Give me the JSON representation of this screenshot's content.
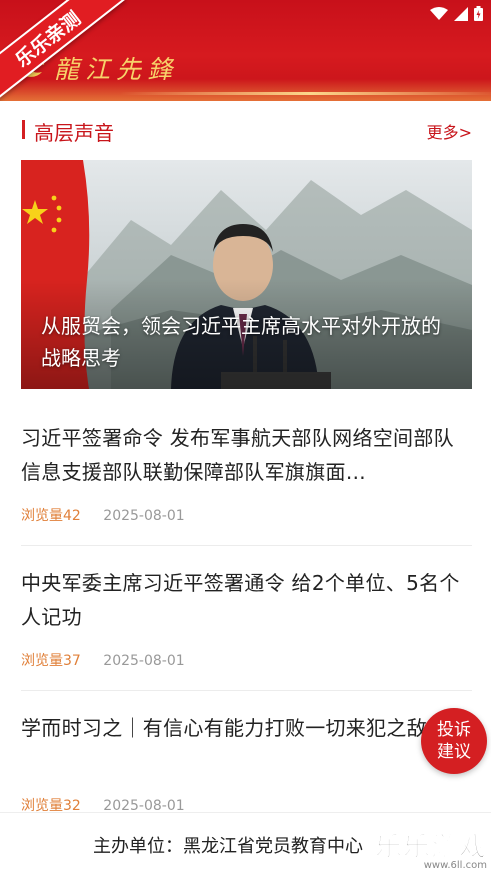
{
  "header": {
    "brand_title": "龍江先鋒",
    "corner_ribbon": "乐乐亲测",
    "colors": {
      "primary": "#c8101a",
      "gold": "#f7d26a"
    }
  },
  "status_bar": {
    "icons": [
      "wifi-icon",
      "signal-icon",
      "battery-icon"
    ]
  },
  "section": {
    "title": "高层声音",
    "more_label": "更多>"
  },
  "feature": {
    "caption": "从服贸会，领会习近平主席高水平对外开放的战略思考"
  },
  "news": [
    {
      "title": "习近平签署命令 发布军事航天部队网络空间部队信息支援部队联勤保障部队军旗旗面…",
      "views": "浏览量42",
      "date": "2025-08-01"
    },
    {
      "title": "中央军委主席习近平签署通令 给2个单位、5名个人记功",
      "views": "浏览量37",
      "date": "2025-08-01"
    },
    {
      "title": "学而时习之｜有信心有能力打败一切来犯之敌",
      "views": "浏览量32",
      "date": "2025-08-01"
    }
  ],
  "float_button": {
    "line1": "投诉",
    "line2": "建议"
  },
  "footer": {
    "organizer": "主办单位：黑龙江省党员教育中心",
    "watermark_main": "乐乐游戏",
    "watermark_sub": "www.6ll.com"
  }
}
